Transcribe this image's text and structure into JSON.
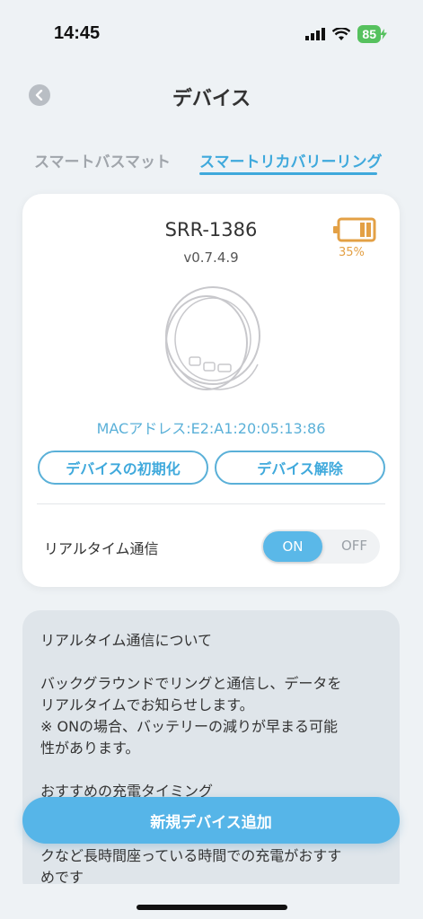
{
  "status_bar": {
    "time": "14:45",
    "battery": "85"
  },
  "nav": {
    "title": "デバイス"
  },
  "tabs": [
    {
      "label": "スマートバスマット",
      "active": false
    },
    {
      "label": "スマートリカバリーリング",
      "active": true
    }
  ],
  "device": {
    "name": "SRR-1386",
    "firmware": "v0.7.4.9",
    "battery_percent": "35%",
    "mac": "MACアドレス:E2:A1:20:05:13:86",
    "reset_label": "デバイスの初期化",
    "unpair_label": "デバイス解除"
  },
  "realtime": {
    "label": "リアルタイム通信",
    "on_label": "ON",
    "off_label": "OFF",
    "state": "on"
  },
  "info": {
    "heading": "リアルタイム通信について",
    "line1": "バックグラウンドでリングと通信し、データを",
    "line2": "リアルタイムでお知らせします。",
    "line3": "※ ONの場合、バッテリーの減りが早まる可能",
    "line4": "性があります。",
    "line5": "おすすめの充電タイミング",
    "line6": "クなど長時間座っている時間での充電がおすす",
    "line7": "めです"
  },
  "add_button": {
    "label": "新規デバイス追加"
  },
  "colors": {
    "accent": "#3fa9dc",
    "battery_low": "#e3a045",
    "status_battery": "#56c15e"
  }
}
